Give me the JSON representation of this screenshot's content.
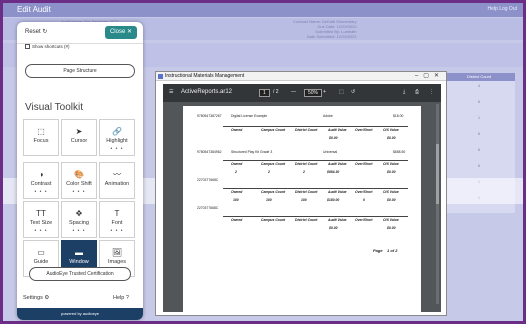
{
  "app": {
    "title": "Edit Audit",
    "header_links": "Help   Log Out",
    "info_left": "Audit Name: Spr Semester 2023\nInstructional Materials Audit 1\nApplied Material Type Filter(s): All",
    "info_right": "Contract Name: DeKalb Elementary\nDue Date: 12/29/2022\nSubmitted By: Lueleath\nDate Submitted: 12/29/2022",
    "table_header": "District Count",
    "table_values": [
      "4",
      "6",
      "1",
      "6",
      "6",
      "6",
      "6",
      "6"
    ]
  },
  "pdf_window": {
    "title": "Instructional Materials Management",
    "file_name": "ActiveReports.ar12",
    "page_current": "1",
    "page_total": "/ 2",
    "zoom": "50%",
    "rows": [
      {
        "code": "9780547387267",
        "desc": "Digital License Example",
        "vendor": "Adobe",
        "price": "$18.00"
      },
      {
        "code": "9780547384962",
        "desc": "Structured Play Kit Grade 3",
        "vendor": "Universal",
        "price": "$658.50"
      },
      {
        "code": "2270377668C",
        "desc": "",
        "vendor": "",
        "price": ""
      },
      {
        "code": "2270377668C",
        "desc": "",
        "vendor": "",
        "price": ""
      }
    ],
    "column_headers": [
      "Owned",
      "Campus Count",
      "District Count",
      "Audit Value",
      "Over/Short",
      "O/S Value"
    ],
    "value_rows": [
      [
        "",
        "",
        "",
        "$0.00",
        "",
        "$0.00"
      ],
      [
        "2",
        "2",
        "2",
        "$684.30",
        "",
        "$0.00"
      ],
      [
        "100",
        "100",
        "100",
        "$180.00",
        "0",
        "$0.00"
      ],
      [
        "",
        "",
        "",
        "$0.00",
        "",
        "$0.00"
      ]
    ],
    "page_footer": "Page    1 of 2"
  },
  "toolkit": {
    "reset": "Reset",
    "close": "Close",
    "shortcuts": "Show shortcuts (#)",
    "page_structure": "Page Structure",
    "heading": "Visual Toolkit",
    "tiles": [
      {
        "label": "Focus",
        "icon": "⬚",
        "active": false
      },
      {
        "label": "Cursor",
        "icon": "➤",
        "active": false
      },
      {
        "label": "Highlight",
        "icon": "🔗",
        "active": false,
        "dots": "• • •"
      },
      {
        "label": "Contrast",
        "icon": "◑",
        "active": false,
        "dots": "• • •"
      },
      {
        "label": "Color Shift",
        "icon": "🎨",
        "active": false,
        "dots": "• • •"
      },
      {
        "label": "Animation",
        "icon": "〰",
        "active": false
      },
      {
        "label": "Text Size",
        "icon": "TT",
        "active": false,
        "dots": "• • •"
      },
      {
        "label": "Spacing",
        "icon": "✥",
        "active": false,
        "dots": "• • •"
      },
      {
        "label": "Font",
        "icon": "T",
        "active": false,
        "dots": "• • •"
      },
      {
        "label": "Guide",
        "icon": "▭",
        "active": false
      },
      {
        "label": "Window",
        "icon": "▬",
        "active": true
      },
      {
        "label": "Images",
        "icon": "🖼",
        "active": false
      }
    ],
    "certification": "AudioEye Trusted Certification",
    "settings": "Settings",
    "help": "Help",
    "powered_by": "powered by   audioeye"
  }
}
